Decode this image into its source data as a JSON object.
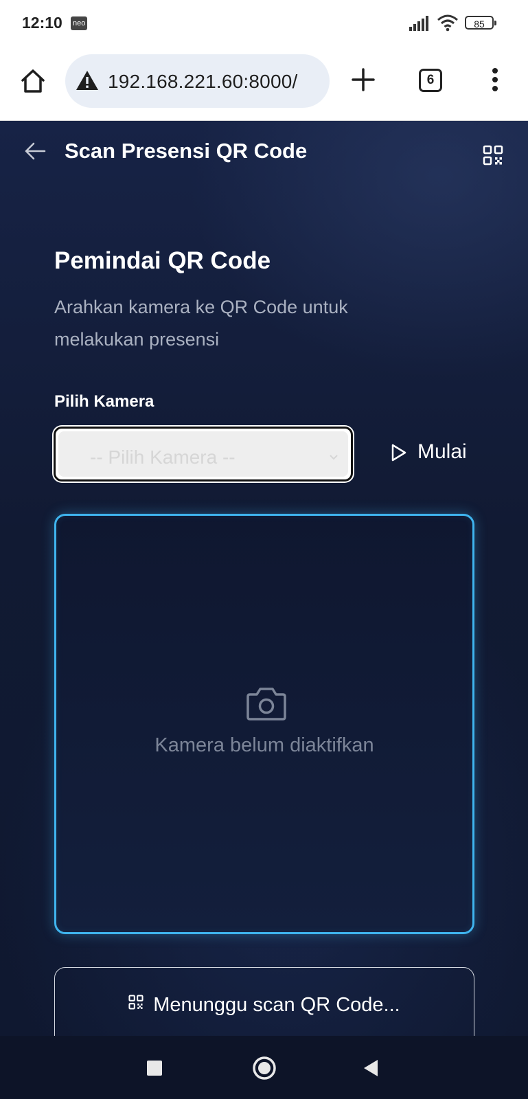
{
  "status_bar": {
    "time": "12:10",
    "carrier_badge": "neo",
    "battery": "85"
  },
  "browser": {
    "url": "192.168.221.60:8000/",
    "tab_count": "6"
  },
  "app": {
    "title": "Scan Presensi QR Code",
    "section_title": "Pemindai QR Code",
    "section_description": "Arahkan kamera ke QR Code untuk melakukan presensi",
    "camera_label": "Pilih Kamera",
    "camera_select_value": "-- Pilih Kamera --",
    "start_button": "Mulai",
    "scanner_placeholder": "Kamera belum diaktifkan",
    "status_text": "Menunggu scan QR Code..."
  },
  "colors": {
    "accent": "#3fb4ee",
    "background": "#0f1830"
  }
}
